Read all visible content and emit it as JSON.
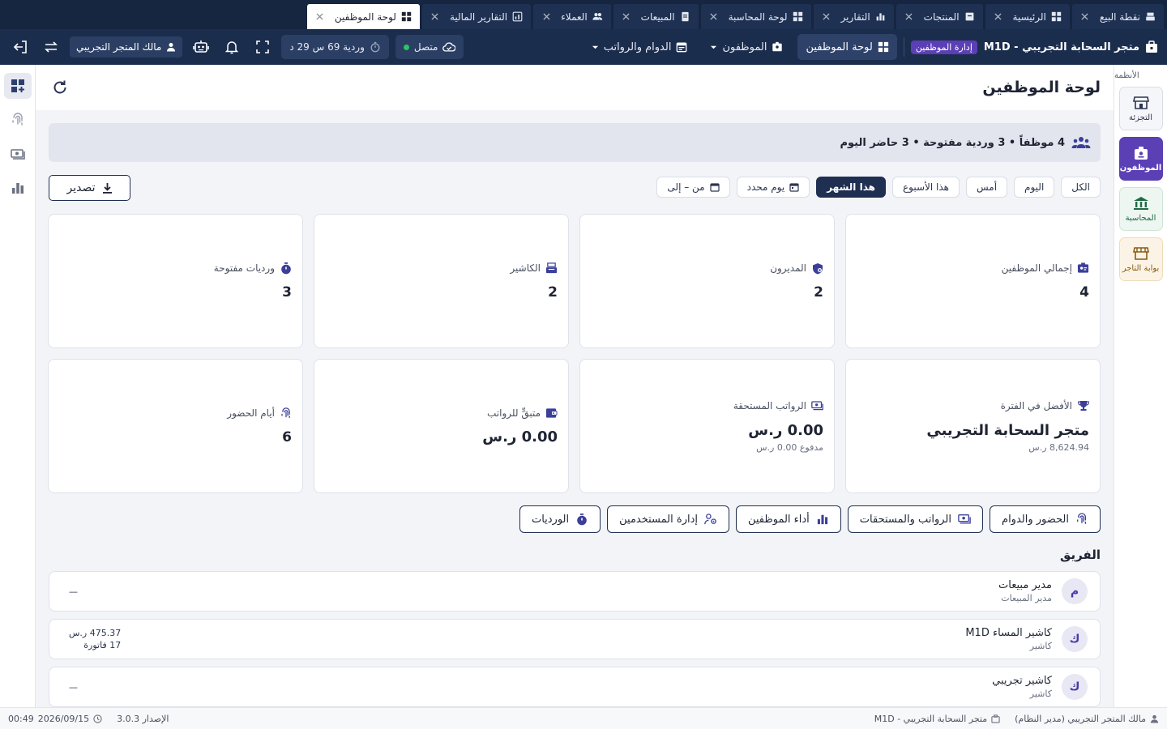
{
  "tabs": [
    {
      "label": "نقطة البيع",
      "icon": "register-icon"
    },
    {
      "label": "الرئيسية",
      "icon": "dashboard-icon"
    },
    {
      "label": "المنتجات",
      "icon": "box-icon"
    },
    {
      "label": "التقارير",
      "icon": "bar-chart-icon"
    },
    {
      "label": "لوحة المحاسبة",
      "icon": "dashboard-icon"
    },
    {
      "label": "المبيعات",
      "icon": "receipt-icon"
    },
    {
      "label": "العملاء",
      "icon": "users-icon"
    },
    {
      "label": "التقارير المالية",
      "icon": "report-icon"
    },
    {
      "label": "لوحة الموظفين",
      "icon": "dashboard-icon",
      "active": true
    }
  ],
  "header": {
    "store_name": "متجر السحابة التجريبي - M1D",
    "role_badge": "إدارة الموظفين",
    "nav_dashboard": "لوحة الموظفين",
    "nav_employees": "الموظفون",
    "nav_attendance": "الدوام والرواتب",
    "status": "متصل",
    "shift": "وردية 69 س 29 د",
    "user": "مالك المتجر التجريبي"
  },
  "rail": {
    "title": "الأنظمة",
    "items": [
      {
        "label": "التجزئة",
        "icon": "store-icon"
      },
      {
        "label": "الموظفون",
        "icon": "id-badge-icon",
        "active": true
      },
      {
        "label": "المحاسبة",
        "icon": "bank-icon"
      },
      {
        "label": "بوابة التاجر",
        "icon": "storefront-icon"
      }
    ]
  },
  "page": {
    "title": "لوحة الموظفين",
    "summary": "4 موظفاً • 3 وردية مفتوحة • 3 حاضر اليوم"
  },
  "filters": {
    "all": "الكل",
    "today": "اليوم",
    "yesterday": "أمس",
    "week": "هذا الأسبوع",
    "month": "هذا الشهر",
    "specific_day": "يوم محدد",
    "range": "من – إلى",
    "active": "هذا الشهر"
  },
  "export_label": "تصدير",
  "cards": {
    "total_employees": {
      "label": "إجمالي الموظفين",
      "value": "4"
    },
    "managers": {
      "label": "المديرون",
      "value": "2"
    },
    "cashiers": {
      "label": "الكاشير",
      "value": "2"
    },
    "open_shifts": {
      "label": "ورديات مفتوحة",
      "value": "3"
    },
    "top_performer": {
      "label": "الأفضل في الفترة",
      "value": "متجر السحابة التجريبي",
      "sub": "8,624.94 ر.س"
    },
    "due_salaries": {
      "label": "الرواتب المستحقة",
      "value": "0.00 ر.س",
      "sub": "مدفوع 0.00 ر.س"
    },
    "remaining_salaries": {
      "label": "متبقٍّ للرواتب",
      "value": "0.00 ر.س"
    },
    "attendance_days": {
      "label": "أيام الحضور",
      "value": "6"
    }
  },
  "quick_links": {
    "attendance": "الحضور والدوام",
    "salaries": "الرواتب والمستحقات",
    "performance": "أداء الموظفين",
    "users": "إدارة المستخدمين",
    "shifts": "الورديات"
  },
  "team": {
    "title": "الفريق",
    "members": [
      {
        "initial": "م",
        "name": "مدير مبيعات",
        "role": "مدير المبيعات",
        "stat1": "—",
        "stat2": ""
      },
      {
        "initial": "ك",
        "name": "كاشير المساء M1D",
        "role": "كاشير",
        "stat1": "475.37 ر.س",
        "stat2": "17 فاتورة"
      },
      {
        "initial": "ك",
        "name": "كاشير تجريبي",
        "role": "كاشير",
        "stat1": "—",
        "stat2": ""
      }
    ]
  },
  "footer": {
    "user": "مالك المتجر التجريبي (مدير النظام)",
    "store": "متجر السحابة التجريبي - M1D",
    "version": "الإصدار 3.0.3",
    "date": "2026/09/15",
    "time": "00:49"
  },
  "colors": {
    "header_bg": "#1b2d4d",
    "tabbar_bg": "#162540",
    "accent_purple": "#5b3fb5",
    "online": "#2fc463"
  }
}
